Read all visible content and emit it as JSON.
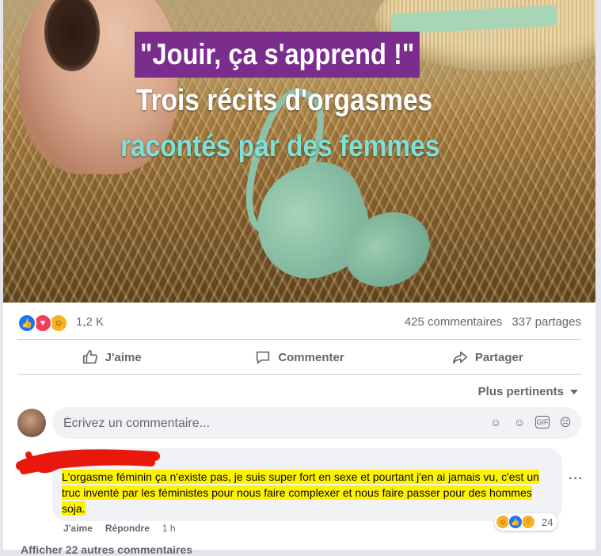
{
  "post": {
    "image": {
      "headline": "\"Jouir, ça s'apprend !\"",
      "subtitle_line1": "Trois récits d'orgasmes",
      "subtitle_line2": "racontés par des femmes"
    },
    "stats": {
      "reaction_count": "1,2 K",
      "comments": "425 commentaires",
      "shares": "337 partages",
      "reaction_icons": [
        "like-icon",
        "love-icon",
        "haha-icon"
      ]
    },
    "actions": {
      "like": "J'aime",
      "comment": "Commenter",
      "share": "Partager"
    },
    "sort_label": "Plus pertinents",
    "composer": {
      "placeholder": "Écrivez un commentaire..."
    },
    "comment": {
      "text": "L'orgasme féminin ça n'existe pas, je suis super fort en sexe et pourtant j'en ai jamais vu, c'est un truc inventé par les féministes pour nous faire complexer et nous faire passer pour des hommes soja.",
      "like_label": "J'aime",
      "reply_label": "Répondre",
      "time": "1 h",
      "reaction_count": "24",
      "highlight_color": "#fff200"
    },
    "more_comments": "Afficher 22 autres commentaires"
  },
  "colors": {
    "headline_bg": "#7b2d8e",
    "subtitle_accent": "#7fe0d6",
    "facebook_blue": "#1877f2"
  }
}
